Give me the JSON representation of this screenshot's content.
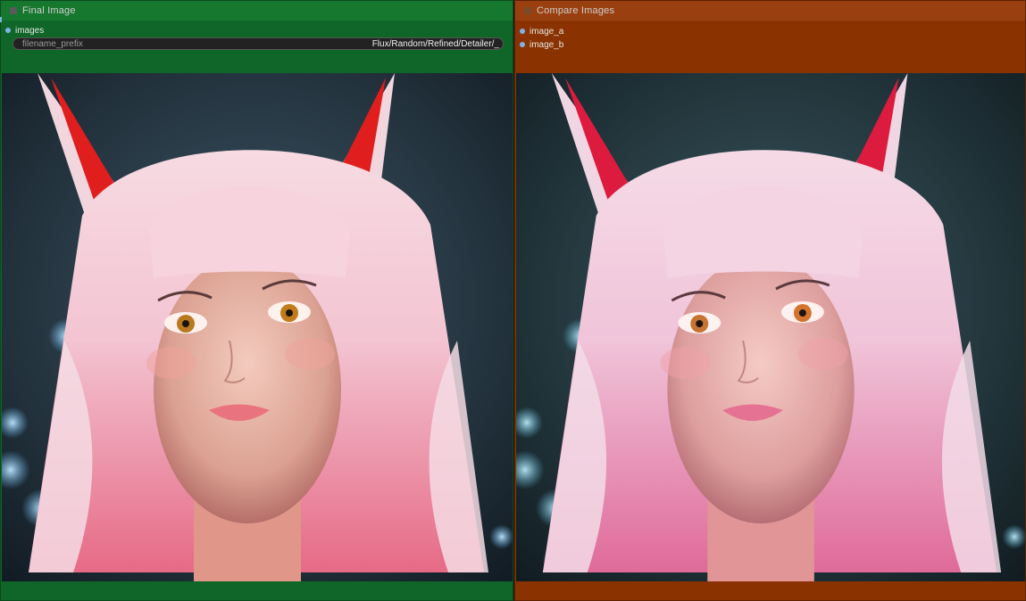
{
  "final_node": {
    "title": "Final Image",
    "input_images": "images",
    "widget_label": "filename_prefix",
    "widget_value": "Flux/Random/Refined/Detailer/_"
  },
  "compare_node": {
    "title": "Compare Images",
    "input_a": "image_a",
    "input_b": "image_b"
  },
  "colors": {
    "final_node_bg": "#0f6628",
    "compare_node_bg": "#8a3300",
    "slot_dot": "#7fb3e6"
  },
  "icons": {
    "collapse": "square-dot-icon",
    "slot": "circle-dot-icon"
  }
}
